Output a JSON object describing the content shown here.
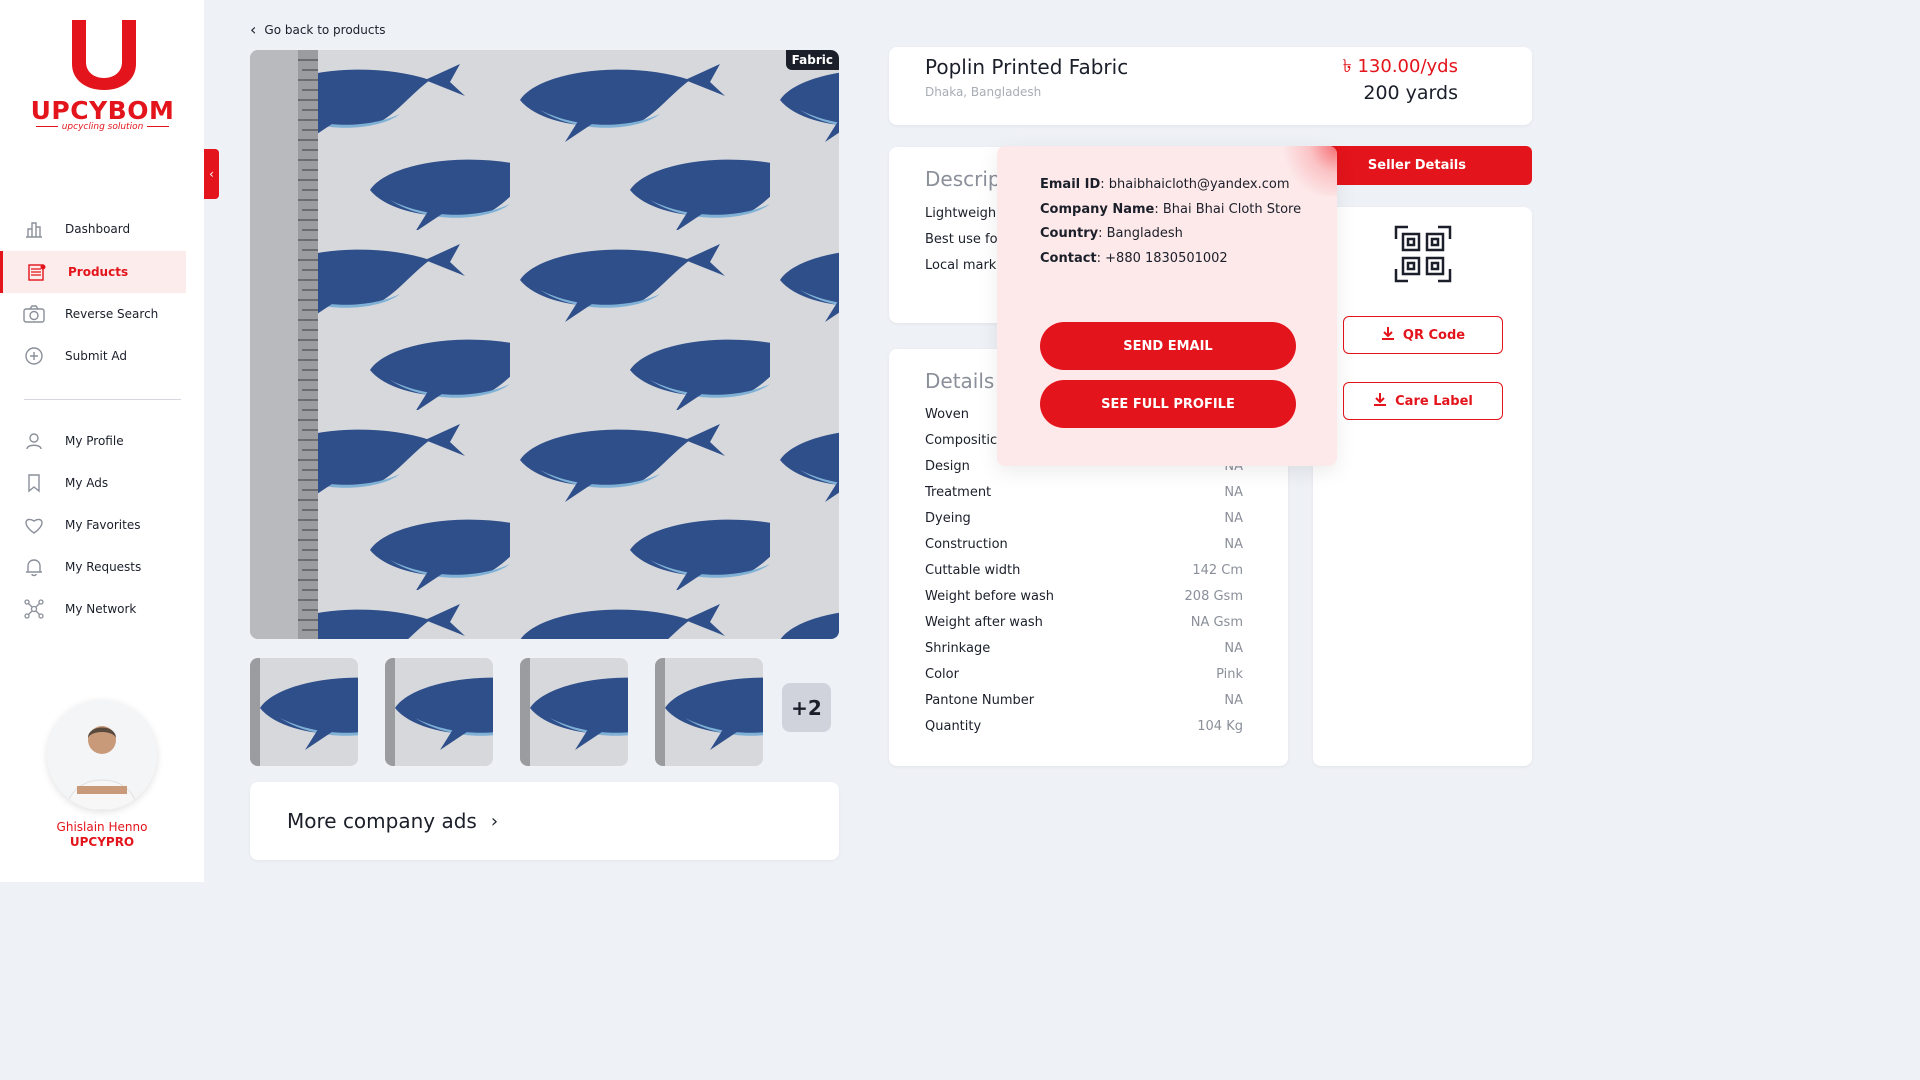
{
  "brand": {
    "name": "UPCYBOM",
    "tagline": "upcycling solution"
  },
  "nav": {
    "primary": [
      {
        "label": "Dashboard",
        "icon": "bar-chart-icon"
      },
      {
        "label": "Products",
        "icon": "fabric-icon",
        "active": true
      },
      {
        "label": "Reverse Search",
        "icon": "camera-icon"
      },
      {
        "label": "Submit Ad",
        "icon": "plus-circle-icon"
      }
    ],
    "secondary": [
      {
        "label": "My Profile",
        "icon": "user-icon"
      },
      {
        "label": "My Ads",
        "icon": "bookmark-icon"
      },
      {
        "label": "My Favorites",
        "icon": "heart-icon"
      },
      {
        "label": "My Requests",
        "icon": "bell-icon"
      },
      {
        "label": "My Network",
        "icon": "network-icon"
      }
    ]
  },
  "user": {
    "name": "Ghislain Henno",
    "org": "UPCYPRO"
  },
  "back_label": "Go back to products",
  "image_badge": "Fabric",
  "more_thumbs_label": "+2",
  "more_ads_label": "More company ads",
  "product": {
    "title": "Poplin Printed Fabric",
    "location": "Dhaka, Bangladesh",
    "price": "৳ 130.00/yds",
    "quantity": "200 yards"
  },
  "description": {
    "title": "Descrip",
    "lines": [
      "Lightweigh",
      "Best use for",
      "Local mark"
    ]
  },
  "details": {
    "title": "Details",
    "rows": [
      {
        "label": "Woven",
        "value": ""
      },
      {
        "label": "Compositic",
        "value": ""
      },
      {
        "label": "Design",
        "value": "NA"
      },
      {
        "label": "Treatment",
        "value": "NA"
      },
      {
        "label": "Dyeing",
        "value": "NA"
      },
      {
        "label": "Construction",
        "value": "NA"
      },
      {
        "label": "Cuttable width",
        "value": "142 Cm"
      },
      {
        "label": "Weight before wash",
        "value": "208 Gsm"
      },
      {
        "label": "Weight after wash",
        "value": "NA Gsm"
      },
      {
        "label": "Shrinkage",
        "value": "NA"
      },
      {
        "label": "Color",
        "value": "Pink"
      },
      {
        "label": "Pantone Number",
        "value": "NA"
      },
      {
        "label": "Quantity",
        "value": "104 Kg"
      }
    ]
  },
  "seller": {
    "button_label": "Seller Details",
    "email_label": "Email ID",
    "email": "bhaibhaicloth@yandex.com",
    "company_label": "Company Name",
    "company": "Bhai Bhai Cloth Store",
    "country_label": "Country",
    "country": "Bangladesh",
    "contact_label": "Contact",
    "contact": "+880 1830501002",
    "send_email": "SEND EMAIL",
    "full_profile": "SEE FULL PROFILE"
  },
  "qr_button": "QR Code",
  "care_button": "Care Label",
  "colors": {
    "accent": "#e3141b",
    "background": "#eef1f6",
    "popup": "#fde9ea"
  }
}
